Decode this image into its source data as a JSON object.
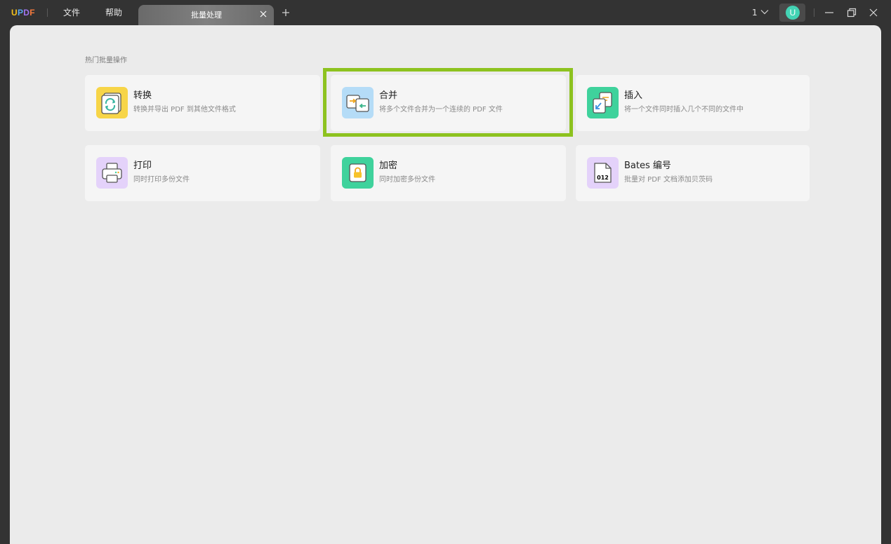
{
  "app": {
    "logo": {
      "letters": [
        "U",
        "P",
        "D",
        "F"
      ],
      "colors": [
        "#f3c11b",
        "#5aa9f0",
        "#a074f0",
        "#f57a3d"
      ]
    },
    "menu": [
      {
        "label": "文件"
      },
      {
        "label": "帮助"
      }
    ],
    "tab": {
      "label": "批量处理",
      "close_icon": "close-icon"
    },
    "add_tab_icon": "plus-icon",
    "page_number": "1",
    "avatar_letter": "U",
    "accent_color": "#8dc21f"
  },
  "main": {
    "section_title": "热门批量操作",
    "cards": [
      {
        "title": "转换",
        "desc": "转换并导出 PDF 到其他文件格式",
        "icon": "convert-icon",
        "icon_bg": "#f7d548"
      },
      {
        "title": "合并",
        "desc": "将多个文件合并为一个连续的 PDF 文件",
        "icon": "merge-icon",
        "icon_bg": "#b5dcf7",
        "highlighted": true
      },
      {
        "title": "插入",
        "desc": "将一个文件同时插入几个不同的文件中",
        "icon": "insert-icon",
        "icon_bg": "#3fd29c"
      },
      {
        "title": "打印",
        "desc": "同时打印多份文件",
        "icon": "print-icon",
        "icon_bg": "#e4d2fa"
      },
      {
        "title": "加密",
        "desc": "同时加密多份文件",
        "icon": "lock-icon",
        "icon_bg": "#3fd29c"
      },
      {
        "title": "Bates 编号",
        "desc": "批量对 PDF 文档添加贝茨码",
        "icon": "bates-number-icon",
        "icon_bg": "#e4d2fa",
        "icon_text": "012"
      }
    ]
  }
}
